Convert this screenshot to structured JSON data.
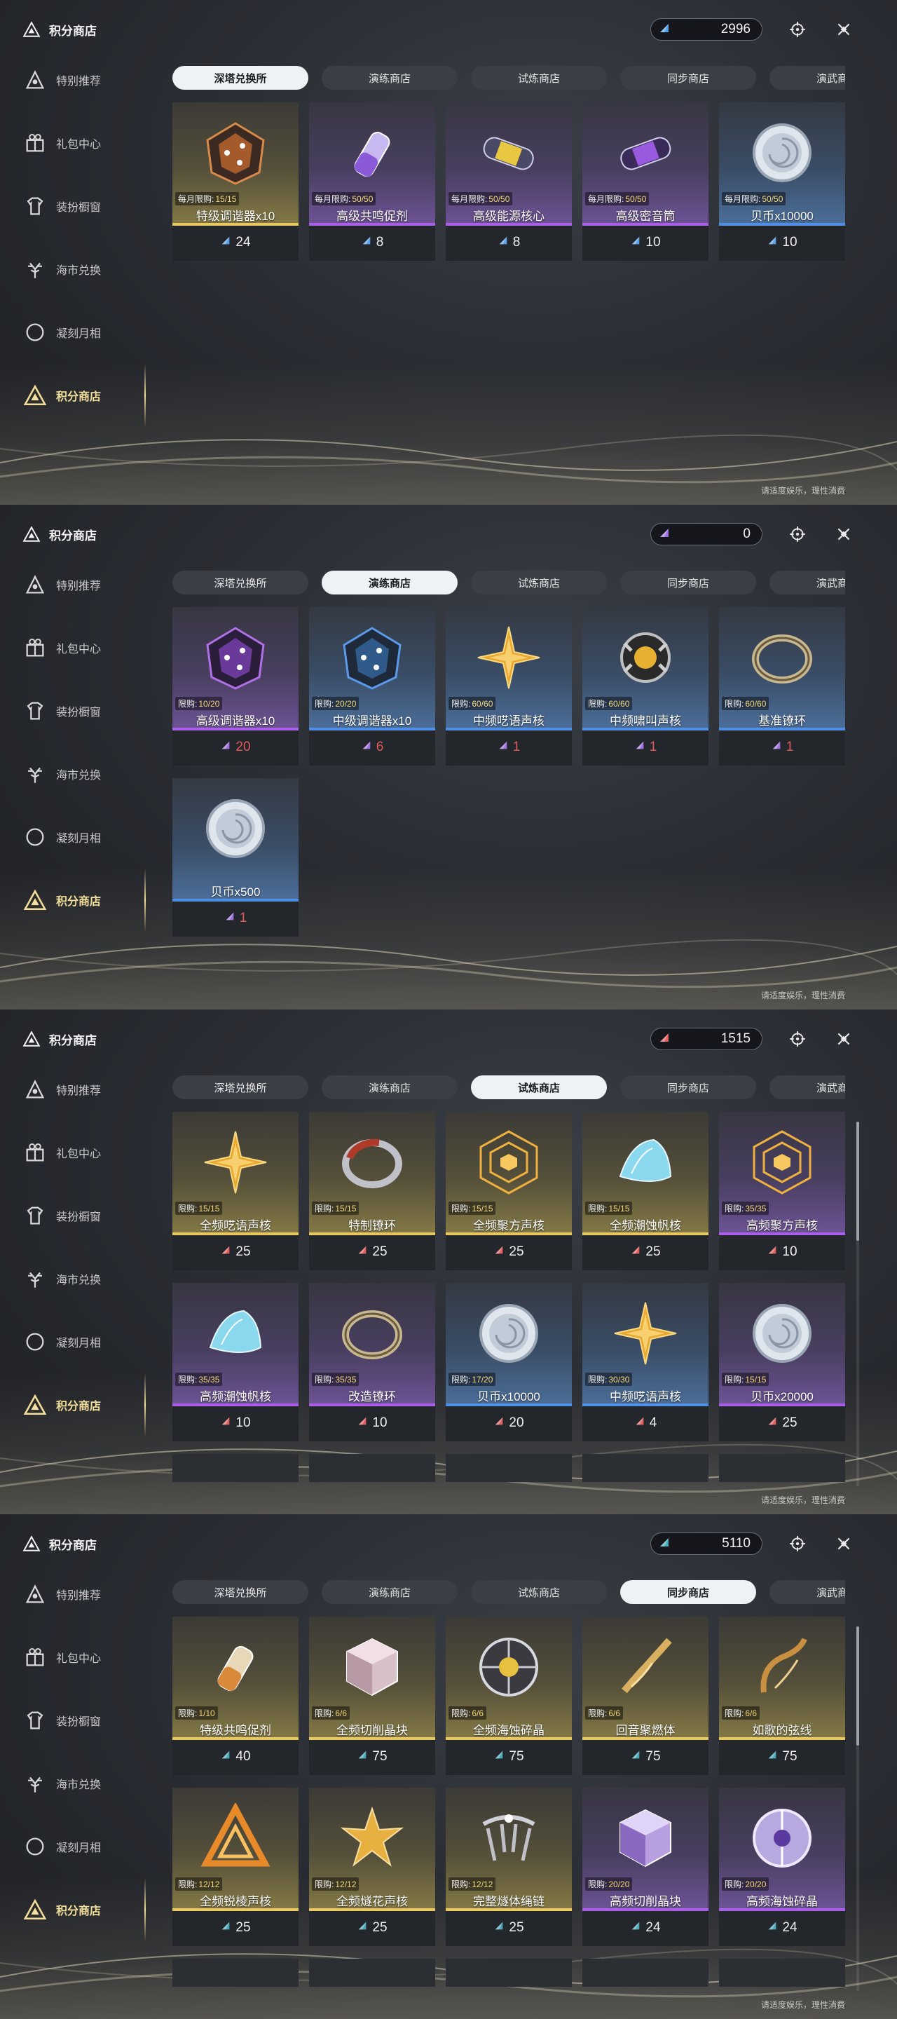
{
  "app_title": "积分商店",
  "footer_note": "请适度娱乐，理性消费",
  "colors": {
    "accent_gold": "#f3df9a",
    "tab_active": "#eef2f4",
    "currency_blue": "#5aa0e8",
    "currency_purple": "#a070e0",
    "currency_red": "#e06060",
    "currency_teal": "#4aa8b8"
  },
  "sidebar": [
    {
      "label": "特别推荐",
      "icon": "star-badge-icon"
    },
    {
      "label": "礼包中心",
      "icon": "gift-icon"
    },
    {
      "label": "装扮橱窗",
      "icon": "shirt-icon"
    },
    {
      "label": "海市兑换",
      "icon": "coral-icon"
    },
    {
      "label": "凝刻月相",
      "icon": "moon-icon"
    },
    {
      "label": "积分商店",
      "icon": "triangle-emblem-icon",
      "active": true
    }
  ],
  "tabs": [
    "深塔兑换所",
    "演练商店",
    "试炼商店",
    "同步商店",
    "演武商店"
  ],
  "panels": [
    {
      "active_tab": 0,
      "currency": {
        "amount": "2996",
        "icon": "blue-triangle-icon"
      },
      "items": [
        {
          "name": "特级调谐器x10",
          "limit_label": "每月限购:",
          "limit": "15/15",
          "price": "24",
          "rarity": "gold",
          "art": "crystal-orange"
        },
        {
          "name": "高级共鸣促剂",
          "limit_label": "每月限购:",
          "limit": "50/50",
          "price": "8",
          "rarity": "purple",
          "art": "vial-purple"
        },
        {
          "name": "高级能源核心",
          "limit_label": "每月限购:",
          "limit": "50/50",
          "price": "8",
          "rarity": "purple",
          "art": "capsule-gold"
        },
        {
          "name": "高级密音筒",
          "limit_label": "每月限购:",
          "limit": "50/50",
          "price": "10",
          "rarity": "purple",
          "art": "capsule-purple"
        },
        {
          "name": "贝币x10000",
          "limit_label": "每月限购:",
          "limit": "50/50",
          "price": "10",
          "rarity": "blue",
          "art": "coin-silver"
        }
      ]
    },
    {
      "active_tab": 1,
      "currency": {
        "amount": "0",
        "icon": "purple-triangle-icon"
      },
      "items": [
        {
          "name": "高级调谐器x10",
          "limit_label": "限购:",
          "limit": "10/20",
          "price": "20",
          "price_red": true,
          "rarity": "purple",
          "art": "crystal-purple"
        },
        {
          "name": "中级调谐器x10",
          "limit_label": "限购:",
          "limit": "20/20",
          "price": "6",
          "price_red": true,
          "rarity": "blue",
          "art": "crystal-blue"
        },
        {
          "name": "中频呓语声核",
          "limit_label": "限购:",
          "limit": "60/60",
          "price": "1",
          "price_red": true,
          "rarity": "blue",
          "art": "star-gold"
        },
        {
          "name": "中频啸叫声核",
          "limit_label": "限购:",
          "limit": "60/60",
          "price": "1",
          "price_red": true,
          "rarity": "blue",
          "art": "orb-dark"
        },
        {
          "name": "基准镣环",
          "limit_label": "限购:",
          "limit": "60/60",
          "price": "1",
          "price_red": true,
          "rarity": "blue",
          "art": "ring-steel"
        },
        {
          "name": "贝币x500",
          "limit_label": "",
          "limit": "",
          "price": "1",
          "price_red": true,
          "rarity": "blue",
          "art": "coin-silver"
        }
      ]
    },
    {
      "active_tab": 2,
      "currency": {
        "amount": "1515",
        "icon": "red-triangle-icon"
      },
      "items": [
        {
          "name": "全频呓语声核",
          "limit_label": "限购:",
          "limit": "15/15",
          "price": "25",
          "rarity": "gold",
          "art": "star-gold"
        },
        {
          "name": "特制镣环",
          "limit_label": "限购:",
          "limit": "15/15",
          "price": "25",
          "rarity": "gold",
          "art": "ring-red"
        },
        {
          "name": "全频聚方声核",
          "limit_label": "限购:",
          "limit": "15/15",
          "price": "25",
          "rarity": "gold",
          "art": "web-gold"
        },
        {
          "name": "全频潮蚀帆核",
          "limit_label": "限购:",
          "limit": "15/15",
          "price": "25",
          "rarity": "gold",
          "art": "shell-cyan"
        },
        {
          "name": "高频聚方声核",
          "limit_label": "限购:",
          "limit": "35/35",
          "price": "10",
          "rarity": "purple",
          "art": "web-gold"
        },
        {
          "name": "高频潮蚀帆核",
          "limit_label": "限购:",
          "limit": "35/35",
          "price": "10",
          "rarity": "purple",
          "art": "shell-cyan"
        },
        {
          "name": "改造镣环",
          "limit_label": "限购:",
          "limit": "35/35",
          "price": "10",
          "rarity": "purple",
          "art": "ring-steel"
        },
        {
          "name": "贝币x10000",
          "limit_label": "限购:",
          "limit": "17/20",
          "price": "20",
          "rarity": "blue",
          "art": "coin-silver"
        },
        {
          "name": "中频呓语声核",
          "limit_label": "限购:",
          "limit": "30/30",
          "price": "4",
          "rarity": "blue",
          "art": "star-gold"
        },
        {
          "name": "贝币x20000",
          "limit_label": "限购:",
          "limit": "15/15",
          "price": "25",
          "rarity": "purple",
          "art": "coin-silver"
        }
      ]
    },
    {
      "active_tab": 3,
      "currency": {
        "amount": "5110",
        "icon": "teal-triangle-icon"
      },
      "items": [
        {
          "name": "特级共鸣促剂",
          "limit_label": "限购:",
          "limit": "1/10",
          "price": "40",
          "rarity": "gold",
          "art": "vial-gold"
        },
        {
          "name": "全频切削晶块",
          "limit_label": "限购:",
          "limit": "6/6",
          "price": "75",
          "rarity": "gold",
          "art": "cube-pink"
        },
        {
          "name": "全频海蚀碎晶",
          "limit_label": "限购:",
          "limit": "6/6",
          "price": "75",
          "rarity": "gold",
          "art": "disc-silver"
        },
        {
          "name": "回音聚燃体",
          "limit_label": "限购:",
          "limit": "6/6",
          "price": "75",
          "rarity": "gold",
          "art": "spiral-gold"
        },
        {
          "name": "如歌的弦线",
          "limit_label": "限购:",
          "limit": "6/6",
          "price": "75",
          "rarity": "gold",
          "art": "string-gold"
        },
        {
          "name": "全频锐棱声核",
          "limit_label": "限购:",
          "limit": "12/12",
          "price": "25",
          "rarity": "gold",
          "art": "triangle-gold"
        },
        {
          "name": "全频燧花声核",
          "limit_label": "限购:",
          "limit": "12/12",
          "price": "25",
          "rarity": "gold",
          "art": "flower-gold"
        },
        {
          "name": "完整燧体绳链",
          "limit_label": "限购:",
          "limit": "12/12",
          "price": "25",
          "rarity": "gold",
          "art": "chain-silver"
        },
        {
          "name": "高频切削晶块",
          "limit_label": "限购:",
          "limit": "20/20",
          "price": "24",
          "rarity": "purple",
          "art": "cube-purple"
        },
        {
          "name": "高频海蚀碎晶",
          "limit_label": "限购:",
          "limit": "20/20",
          "price": "24",
          "rarity": "purple",
          "art": "disc-purple"
        }
      ]
    }
  ]
}
